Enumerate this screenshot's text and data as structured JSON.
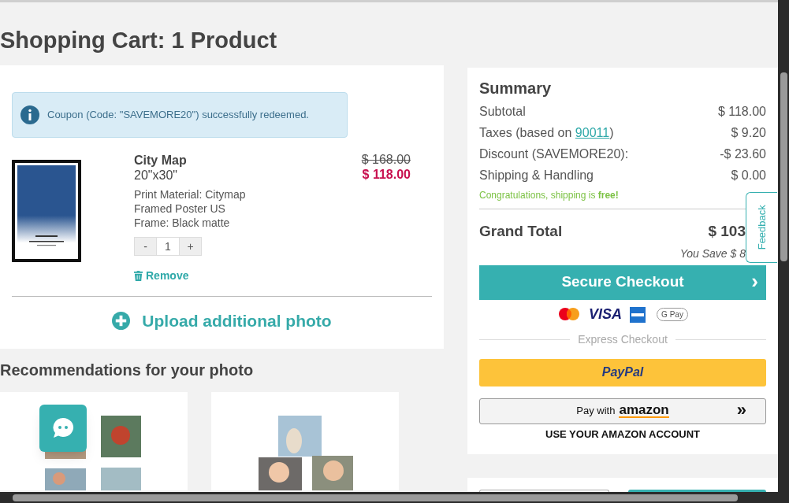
{
  "page_title": "Shopping Cart: 1 Product",
  "notice": {
    "text": "Coupon (Code: \"SAVEMORE20\") successfully redeemed."
  },
  "cart_item": {
    "name": "City Map",
    "size": "20\"x30\"",
    "old_price": "$ 168.00",
    "price": "$ 118.00",
    "details": [
      "Print Material: Citymap",
      "Framed Poster US",
      "Frame: Black matte"
    ],
    "quantity": {
      "minus": "-",
      "value": "1",
      "plus": "+"
    },
    "remove": "Remove"
  },
  "upload_link": "Upload additional photo",
  "recommendations": {
    "title": "Recommendations for your photo"
  },
  "summary": {
    "title": "Summary",
    "rows": [
      {
        "label": "Subtotal",
        "value": "$ 118.00"
      },
      {
        "label": "Taxes (based on ",
        "link": "90011",
        "suffix": ")",
        "value": "$ 9.20"
      },
      {
        "label": "Discount (SAVEMORE20):",
        "value": "-$ 23.60"
      },
      {
        "label": "Shipping & Handling",
        "value": "$ 0.00"
      }
    ],
    "shipping_note": "Congratulations, shipping is **free!**",
    "grand_total_label": "Grand Total",
    "grand_total": "$ 103",
    "you_save": "You Save $ 8",
    "checkout_button": "Secure Checkout",
    "checkout_arrow": "›",
    "card_logos": [
      "VISA",
      "G Pay"
    ],
    "express_label": "Express Checkout",
    "paypal": "PayPal",
    "amazon": {
      "prefix": "Pay with",
      "brand": "amazon",
      "arrow": "»",
      "caption": "USE YOUR AMAZON ACCOUNT"
    }
  },
  "feedback_tab": "Feedback"
}
